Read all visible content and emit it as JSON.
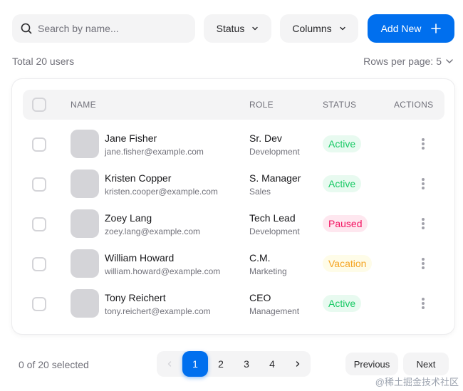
{
  "search": {
    "placeholder": "Search by name..."
  },
  "filters": {
    "status_label": "Status",
    "columns_label": "Columns"
  },
  "add_button": {
    "label": "Add New"
  },
  "summary": {
    "total": "Total 20 users",
    "rows_per_page_label": "Rows per page:",
    "rows_per_page_value": "5"
  },
  "table": {
    "headers": {
      "name": "NAME",
      "role": "ROLE",
      "status": "STATUS",
      "actions": "ACTIONS"
    },
    "rows": [
      {
        "name": "Jane Fisher",
        "email": "jane.fisher@example.com",
        "role": "Sr. Dev",
        "team": "Development",
        "status": "Active"
      },
      {
        "name": "Kristen Copper",
        "email": "kristen.cooper@example.com",
        "role": "S. Manager",
        "team": "Sales",
        "status": "Active"
      },
      {
        "name": "Zoey Lang",
        "email": "zoey.lang@example.com",
        "role": "Tech Lead",
        "team": "Development",
        "status": "Paused"
      },
      {
        "name": "William Howard",
        "email": "william.howard@example.com",
        "role": "C.M.",
        "team": "Marketing",
        "status": "Vacation"
      },
      {
        "name": "Tony Reichert",
        "email": "tony.reichert@example.com",
        "role": "CEO",
        "team": "Management",
        "status": "Active"
      }
    ]
  },
  "footer": {
    "selected": "0 of 20 selected",
    "pages": [
      "1",
      "2",
      "3",
      "4"
    ],
    "current_page": "1",
    "previous_label": "Previous",
    "next_label": "Next"
  },
  "watermark": "@稀土掘金技术社区",
  "colors": {
    "primary": "#006fee",
    "success": "#17c964",
    "danger": "#f31260",
    "warning": "#f5a524"
  }
}
